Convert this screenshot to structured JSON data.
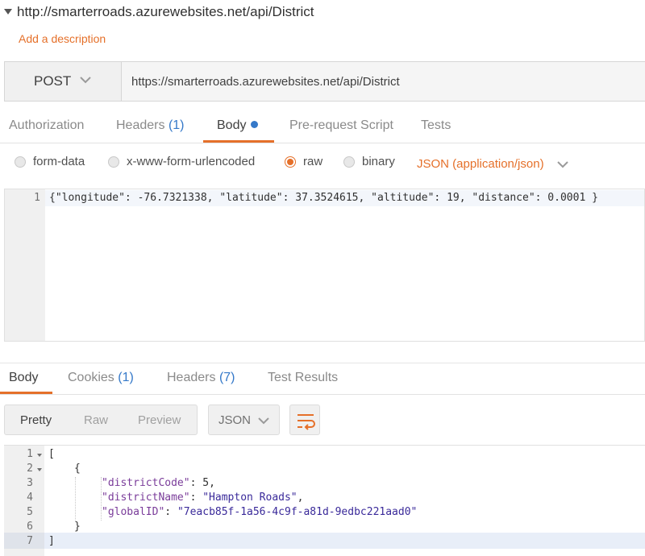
{
  "request": {
    "title": "http://smarterroads.azurewebsites.net/api/District",
    "add_description": "Add a description",
    "method": "POST",
    "url": "https://smarterroads.azurewebsites.net/api/District"
  },
  "request_tabs": [
    {
      "label": "Authorization",
      "count": ""
    },
    {
      "label": "Headers",
      "count": "(1)"
    },
    {
      "label": "Body",
      "count": ""
    },
    {
      "label": "Pre-request Script",
      "count": ""
    },
    {
      "label": "Tests",
      "count": ""
    }
  ],
  "body_types": [
    "form-data",
    "x-www-form-urlencoded",
    "raw",
    "binary"
  ],
  "body_type_selected": "raw",
  "content_type": "JSON (application/json)",
  "request_editor": {
    "line_numbers": [
      "1"
    ],
    "lines": [
      "{\"longitude\": -76.7321338, \"latitude\": 37.3524615, \"altitude\": 19, \"distance\": 0.0001 }"
    ]
  },
  "response_tabs": [
    {
      "label": "Body",
      "count": ""
    },
    {
      "label": "Cookies",
      "count": "(1)"
    },
    {
      "label": "Headers",
      "count": "(7)"
    },
    {
      "label": "Test Results",
      "count": ""
    }
  ],
  "view_modes": [
    "Pretty",
    "Raw",
    "Preview"
  ],
  "view_mode_selected": "Pretty",
  "format": "JSON",
  "response_editor": {
    "line_numbers": [
      "1",
      "2",
      "3",
      "4",
      "5",
      "6",
      "7"
    ],
    "open_bracket": "[",
    "open_brace": "{",
    "k1": "\"districtCode\"",
    "v1": "5",
    "k2": "\"districtName\"",
    "v2": "\"Hampton Roads\"",
    "k3": "\"globalID\"",
    "v3": "\"7eacb85f-1a56-4c9f-a81d-9edbc221aad0\"",
    "close_brace": "}",
    "close_bracket": "]"
  },
  "colors": {
    "accent": "#e5702a",
    "link_blue": "#3579c9"
  }
}
